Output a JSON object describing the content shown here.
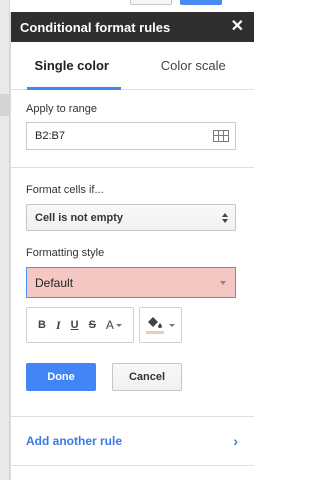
{
  "panel": {
    "title": "Conditional format rules",
    "close_icon": "close-icon"
  },
  "tabs": [
    {
      "label": "Single color",
      "active": true
    },
    {
      "label": "Color scale",
      "active": false
    }
  ],
  "range": {
    "label": "Apply to range",
    "value": "B2:B7",
    "icon": "grid-select-icon"
  },
  "condition": {
    "label": "Format cells if...",
    "selected": "Cell is not empty"
  },
  "style": {
    "label": "Formatting style",
    "selected": "Default",
    "fill_color": "#f4c7c3",
    "buttons": {
      "bold": "B",
      "italic": "I",
      "underline": "U",
      "strikethrough": "S",
      "text_color": "A"
    }
  },
  "actions": {
    "done": "Done",
    "cancel": "Cancel"
  },
  "add_rule": {
    "label": "Add another rule",
    "chevron": "›"
  },
  "colors": {
    "accent": "#4285f4",
    "header_bg": "#2f2f2f",
    "link": "#3b78e7"
  }
}
